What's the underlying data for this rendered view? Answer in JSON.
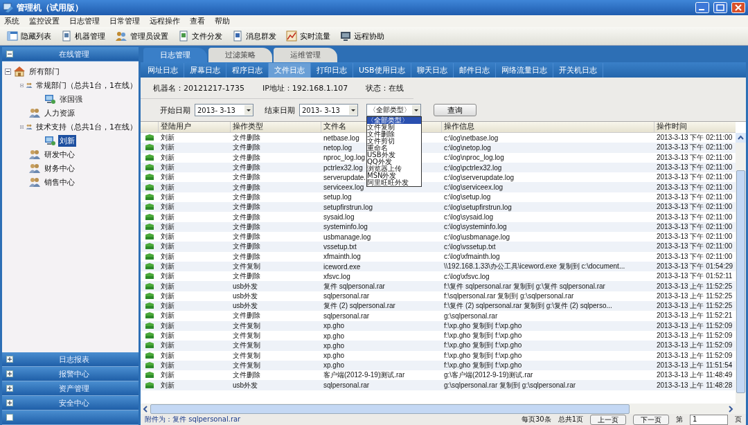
{
  "window": {
    "title": "管理机（试用版）"
  },
  "menu": [
    "系统",
    "监控设置",
    "日志管理",
    "日常管理",
    "远程操作",
    "查看",
    "帮助"
  ],
  "toolbar": [
    {
      "label": "隐藏列表",
      "kind": "list"
    },
    {
      "label": "机器管理",
      "kind": "machine"
    },
    {
      "label": "管理员设置",
      "kind": "users"
    },
    {
      "label": "文件分发",
      "kind": "file"
    },
    {
      "label": "消息群发",
      "kind": "message"
    },
    {
      "label": "实时流量",
      "kind": "chart"
    },
    {
      "label": "远程协助",
      "kind": "monitor"
    }
  ],
  "sidebar": {
    "sections": [
      {
        "label": "在线管理",
        "expanded": true
      },
      {
        "label": "日志报表",
        "expanded": false
      },
      {
        "label": "报警中心",
        "expanded": false
      },
      {
        "label": "资产管理",
        "expanded": false
      },
      {
        "label": "安全中心",
        "expanded": false
      }
    ],
    "tree": [
      {
        "label": "所有部门",
        "kind": "root",
        "expanded": true,
        "selected": false,
        "children": [
          {
            "label": "常规部门（总共1台，1在线）",
            "kind": "group",
            "expanded": true,
            "selected": false,
            "children": [
              {
                "label": "张国强",
                "kind": "machine",
                "selected": false
              }
            ]
          },
          {
            "label": "人力资源",
            "kind": "group",
            "selected": false
          },
          {
            "label": "技术支持（总共1台，1在线）",
            "kind": "group",
            "expanded": true,
            "selected": false,
            "children": [
              {
                "label": "刘新",
                "kind": "machine",
                "selected": true
              }
            ]
          },
          {
            "label": "研发中心",
            "kind": "group",
            "selected": false
          },
          {
            "label": "财务中心",
            "kind": "group",
            "selected": false
          },
          {
            "label": "销售中心",
            "kind": "group",
            "selected": false
          }
        ]
      }
    ]
  },
  "tabs": [
    {
      "label": "日志管理",
      "selected": true
    },
    {
      "label": "过滤策略",
      "selected": false
    },
    {
      "label": "运维管理",
      "selected": false
    }
  ],
  "subtabs": [
    {
      "label": "网址日志",
      "selected": false
    },
    {
      "label": "屏幕日志",
      "selected": false
    },
    {
      "label": "程序日志",
      "selected": false
    },
    {
      "label": "文件日志",
      "selected": true
    },
    {
      "label": "打印日志",
      "selected": false
    },
    {
      "label": "USB使用日志",
      "selected": false
    },
    {
      "label": "聊天日志",
      "selected": false
    },
    {
      "label": "邮件日志",
      "selected": false
    },
    {
      "label": "网络流量日志",
      "selected": false
    },
    {
      "label": "开关机日志",
      "selected": false
    }
  ],
  "info": [
    "机器名：20121217-1735",
    "IP地址：192.168.1.107",
    "状态：在线"
  ],
  "filters": {
    "start_label": "开始日期",
    "start_value": "2013- 3-13",
    "end_label": "结束日期",
    "end_value": "2013- 3-13",
    "type": {
      "value": "〈全部类型〉",
      "open": true,
      "options": [
        {
          "label": "〈全部类型〉",
          "selected": true
        },
        {
          "label": "文件复制",
          "selected": false
        },
        {
          "label": "文件删除",
          "selected": false
        },
        {
          "label": "文件剪切",
          "selected": false
        },
        {
          "label": "重命名",
          "selected": false
        },
        {
          "label": "USB外发",
          "selected": false
        },
        {
          "label": "QQ外发",
          "selected": false
        },
        {
          "label": "浏览器上传",
          "selected": false
        },
        {
          "label": "MSN外发",
          "selected": false
        },
        {
          "label": "阿里旺旺外发",
          "selected": false
        }
      ]
    },
    "query_button": "查询"
  },
  "table": {
    "columns": [
      "登陆用户",
      "操作类型",
      "文件名",
      "操作信息",
      "操作时间"
    ],
    "rows": [
      [
        "刘新",
        "文件删除",
        "netbase.log",
        "c:\\log\\netbase.log",
        "2013-3-13 下午 02:11:00"
      ],
      [
        "刘新",
        "文件删除",
        "netop.log",
        "c:\\log\\netop.log",
        "2013-3-13 下午 02:11:00"
      ],
      [
        "刘新",
        "文件删除",
        "nproc_log.log",
        "c:\\log\\nproc_log.log",
        "2013-3-13 下午 02:11:00"
      ],
      [
        "刘新",
        "文件删除",
        "pctrlex32.log",
        "c:\\log\\pctrlex32.log",
        "2013-3-13 下午 02:11:00"
      ],
      [
        "刘新",
        "文件删除",
        "serverupdate.",
        "c:\\log\\serverupdate.log",
        "2013-3-13 下午 02:11:00"
      ],
      [
        "刘新",
        "文件删除",
        "serviceex.log",
        "c:\\log\\serviceex.log",
        "2013-3-13 下午 02:11:00"
      ],
      [
        "刘新",
        "文件删除",
        "setup.log",
        "c:\\log\\setup.log",
        "2013-3-13 下午 02:11:00"
      ],
      [
        "刘新",
        "文件删除",
        "setupfirstrun.log",
        "c:\\log\\setupfirstrun.log",
        "2013-3-13 下午 02:11:00"
      ],
      [
        "刘新",
        "文件删除",
        "sysaid.log",
        "c:\\log\\sysaid.log",
        "2013-3-13 下午 02:11:00"
      ],
      [
        "刘新",
        "文件删除",
        "systeminfo.log",
        "c:\\log\\systeminfo.log",
        "2013-3-13 下午 02:11:00"
      ],
      [
        "刘新",
        "文件删除",
        "usbmanage.log",
        "c:\\log\\usbmanage.log",
        "2013-3-13 下午 02:11:00"
      ],
      [
        "刘新",
        "文件删除",
        "vssetup.txt",
        "c:\\log\\vssetup.txt",
        "2013-3-13 下午 02:11:00"
      ],
      [
        "刘新",
        "文件删除",
        "xfmainth.log",
        "c:\\log\\xfmainth.log",
        "2013-3-13 下午 02:11:00"
      ],
      [
        "刘新",
        "文件复制",
        "iceword.exe",
        "\\\\192.168.1.33\\办公工具\\iceword.exe 复制到 c:\\document...",
        "2013-3-13 下午 01:54:29"
      ],
      [
        "刘新",
        "文件删除",
        "xfsvc.log",
        "c:\\log\\xfsvc.log",
        "2013-3-13 下午 01:52:11"
      ],
      [
        "刘新",
        "usb外发",
        "复件 sqlpersonal.rar",
        "f:\\复件 sqlpersonal.rar 复制到 g:\\复件 sqlpersonal.rar",
        "2013-3-13 上午 11:52:25"
      ],
      [
        "刘新",
        "usb外发",
        "sqlpersonal.rar",
        "f:\\sqlpersonal.rar 复制到 g:\\sqlpersonal.rar",
        "2013-3-13 上午 11:52:25"
      ],
      [
        "刘新",
        "usb外发",
        "复件 (2) sqlpersonal.rar",
        "f:\\复件 (2) sqlpersonal.rar 复制到 g:\\复件 (2) sqlperso...",
        "2013-3-13 上午 11:52:25"
      ],
      [
        "刘新",
        "文件删除",
        "sqlpersonal.rar",
        "g:\\sqlpersonal.rar",
        "2013-3-13 上午 11:52:21"
      ],
      [
        "刘新",
        "文件复制",
        "xp.gho",
        "f:\\xp.gho 复制到 f:\\xp.gho",
        "2013-3-13 上午 11:52:09"
      ],
      [
        "刘新",
        "文件复制",
        "xp.gho",
        "f:\\xp.gho 复制到 f:\\xp.gho",
        "2013-3-13 上午 11:52:09"
      ],
      [
        "刘新",
        "文件复制",
        "xp.gho",
        "f:\\xp.gho 复制到 f:\\xp.gho",
        "2013-3-13 上午 11:52:09"
      ],
      [
        "刘新",
        "文件复制",
        "xp.gho",
        "f:\\xp.gho 复制到 f:\\xp.gho",
        "2013-3-13 上午 11:52:09"
      ],
      [
        "刘新",
        "文件复制",
        "xp.gho",
        "f:\\xp.gho 复制到 f:\\xp.gho",
        "2013-3-13 上午 11:51:54"
      ],
      [
        "刘新",
        "文件删除",
        "客户端(2012-9-19)测试.rar",
        "g:\\客户端(2012-9-19)测试.rar",
        "2013-3-13 上午 11:48:49"
      ],
      [
        "刘新",
        "usb外发",
        "sqlpersonal.rar",
        "g:\\sqlpersonal.rar 复制到 g:\\sqlpersonal.rar",
        "2013-3-13 上午 11:48:28"
      ]
    ]
  },
  "status_bar": {
    "attachment": "附件为：复件 sqlpersonal.rar",
    "per_page": "每页30条",
    "total": "总共1页",
    "prev": "上一页",
    "next": "下一页",
    "page_prefix": "第",
    "page": "1",
    "page_suffix": "页"
  }
}
